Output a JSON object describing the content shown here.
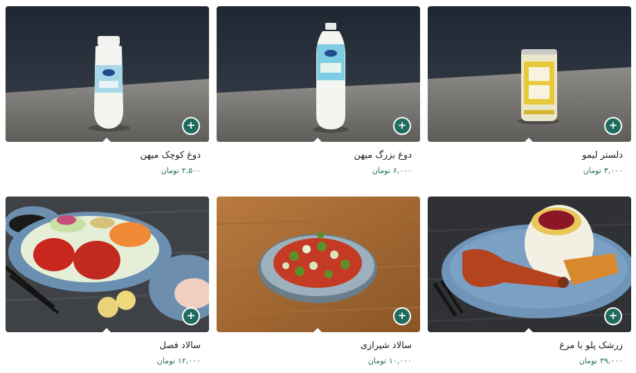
{
  "menu": {
    "items": [
      {
        "name": "دوغ کوچک میهن",
        "price": "۲,۵۰۰",
        "currency": "تومان",
        "add_icon": "+",
        "image": "small-doogh-bottle"
      },
      {
        "name": "دوغ بزرگ میهن",
        "price": "۶,۰۰۰",
        "currency": "تومان",
        "add_icon": "+",
        "image": "large-doogh-bottle"
      },
      {
        "name": "دلستر لیمو",
        "price": "۳,۰۰۰",
        "currency": "تومان",
        "add_icon": "+",
        "image": "lemon-malt-drink-can"
      },
      {
        "name": "سالاد فصل",
        "price": "۱۲,۰۰۰",
        "currency": "تومان",
        "add_icon": "+",
        "image": "seasonal-salad-plate"
      },
      {
        "name": "سالاد شیرازی",
        "price": "۱۰,۰۰۰",
        "currency": "تومان",
        "add_icon": "+",
        "image": "shirazi-salad-bowl"
      },
      {
        "name": "زرشک پلو با مرغ",
        "price": "۳۹,۰۰۰",
        "currency": "تومان",
        "add_icon": "+",
        "image": "barberry-rice-chicken-plate"
      }
    ]
  },
  "colors": {
    "accent": "#1f6b5e",
    "text": "#1a1a1a",
    "background": "#ffffff"
  }
}
